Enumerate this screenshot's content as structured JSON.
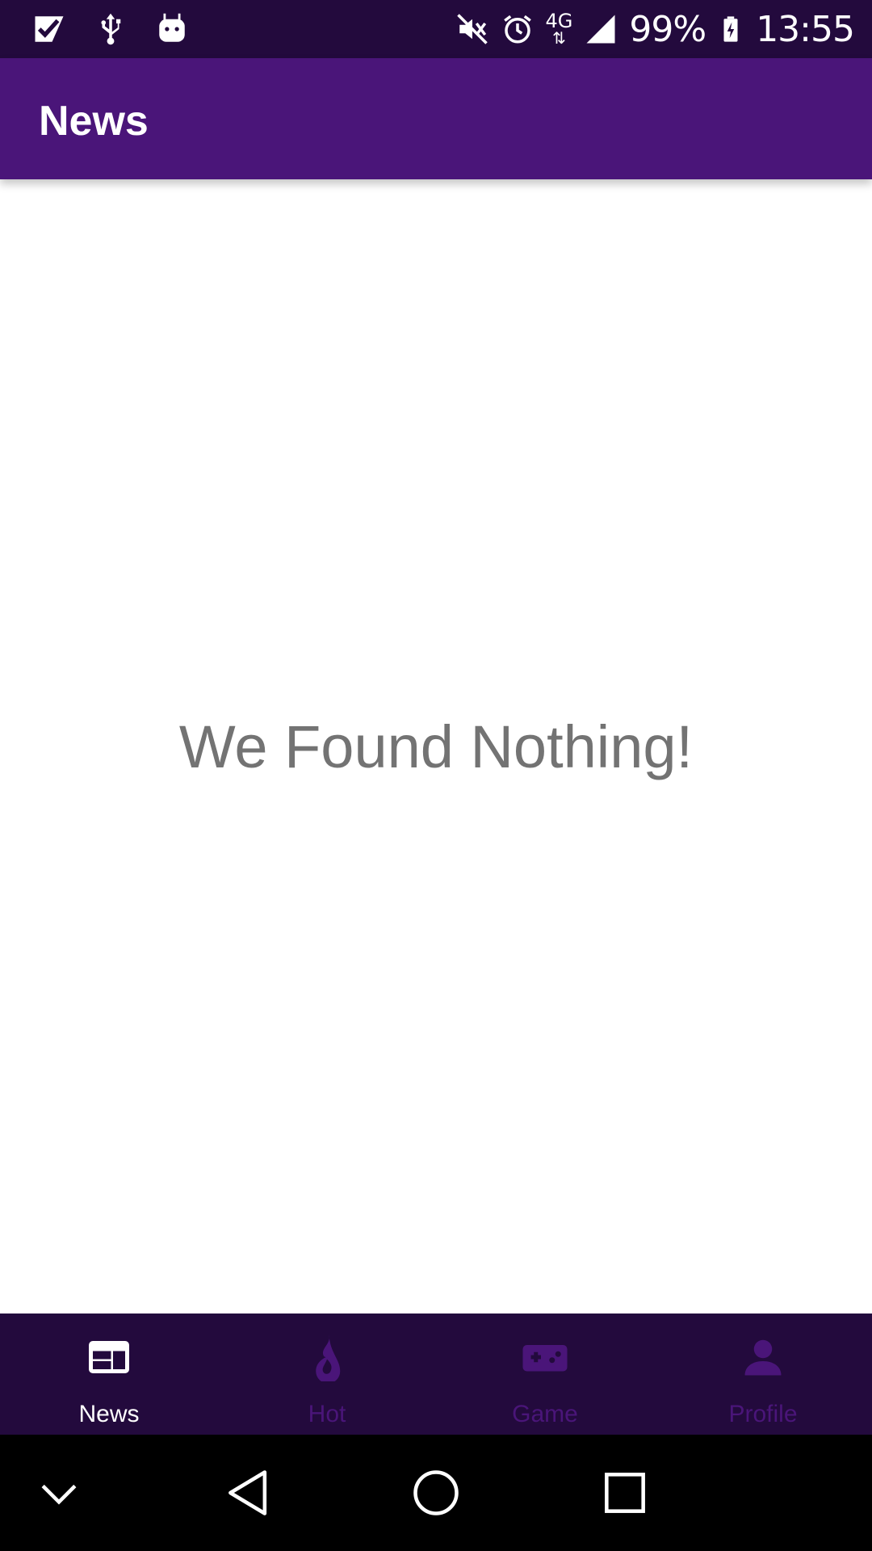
{
  "status_bar": {
    "left_icons": [
      "task-check-icon",
      "usb-icon",
      "android-icon"
    ],
    "right_icons": [
      "mute-icon",
      "alarm-icon",
      "network-4g-icon",
      "signal-icon",
      "battery-charging-icon"
    ],
    "network_label": "4G",
    "battery": "99%",
    "time": "13:55"
  },
  "app_bar": {
    "title": "News"
  },
  "content": {
    "empty_message": "We Found Nothing!"
  },
  "bottom_nav": {
    "items": [
      {
        "label": "News",
        "icon": "news-icon",
        "active": true
      },
      {
        "label": "Hot",
        "icon": "flame-icon",
        "active": false
      },
      {
        "label": "Game",
        "icon": "gamepad-icon",
        "active": false
      },
      {
        "label": "Profile",
        "icon": "person-icon",
        "active": false
      }
    ]
  },
  "system_nav": {
    "buttons": [
      "collapse-icon",
      "back-icon",
      "home-icon",
      "recents-icon"
    ]
  },
  "colors": {
    "status_bar": "#230a3d",
    "app_bar": "#4a1579",
    "bottom_nav": "#230a3d",
    "inactive_tab": "#4a1579",
    "active_tab": "#ffffff",
    "empty_text": "#737373"
  }
}
